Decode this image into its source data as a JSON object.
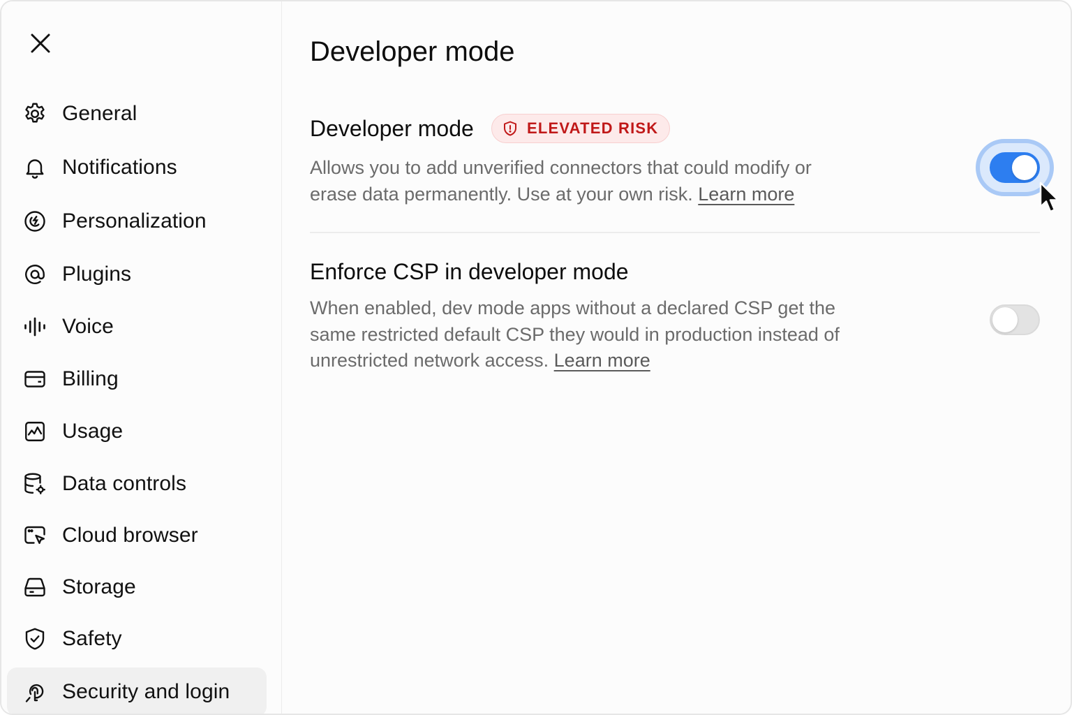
{
  "sidebar": {
    "close_icon": "close-icon",
    "items": [
      {
        "label": "General",
        "icon": "gear-icon"
      },
      {
        "label": "Notifications",
        "icon": "bell-icon"
      },
      {
        "label": "Personalization",
        "icon": "personalization-icon"
      },
      {
        "label": "Plugins",
        "icon": "at-sign-icon"
      },
      {
        "label": "Voice",
        "icon": "waveform-icon"
      },
      {
        "label": "Billing",
        "icon": "wallet-icon"
      },
      {
        "label": "Usage",
        "icon": "chart-icon"
      },
      {
        "label": "Data controls",
        "icon": "database-gear-icon"
      },
      {
        "label": "Cloud browser",
        "icon": "browser-cursor-icon"
      },
      {
        "label": "Storage",
        "icon": "drive-icon"
      },
      {
        "label": "Safety",
        "icon": "shield-check-icon"
      },
      {
        "label": "Security and login",
        "icon": "key-icon",
        "active": true
      }
    ]
  },
  "main": {
    "title": "Developer mode",
    "settings": [
      {
        "title": "Developer mode",
        "badge": "ELEVATED RISK",
        "description": "Allows you to add unverified connectors that could modify or erase data permanently. Use at your own risk.",
        "link": "Learn more",
        "enabled": true
      },
      {
        "title": "Enforce CSP in developer mode",
        "description": "When enabled, dev mode apps without a declared CSP get the same restricted default CSP they would in production instead of unrestricted network access.",
        "link": "Learn more",
        "enabled": false
      }
    ]
  },
  "colors": {
    "accent": "#2d7ef0",
    "danger": "#c01818",
    "danger_bg": "#fdeaea"
  }
}
